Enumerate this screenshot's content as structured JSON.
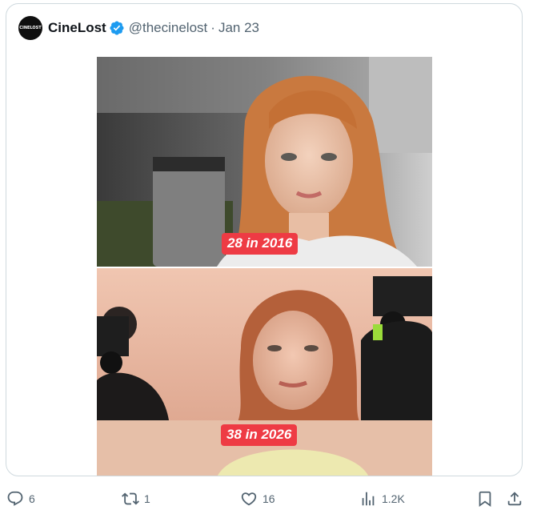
{
  "post": {
    "avatar_text": "CINELOST",
    "display_name": "CineLost",
    "verified_icon": "verified-badge-icon",
    "handle": "@thecinelost",
    "separator": "·",
    "date": "Jan 23"
  },
  "media": {
    "top_caption": "28 in 2016",
    "bottom_caption": "38 in 2026",
    "badge_color": "#ee3b44"
  },
  "actions": {
    "reply_count": "6",
    "repost_count": "1",
    "like_count": "16",
    "views_count": "1.2K"
  },
  "colors": {
    "text": "#0f1419",
    "muted": "#536471",
    "verified": "#1d9bf0",
    "border": "#cfd9de"
  }
}
